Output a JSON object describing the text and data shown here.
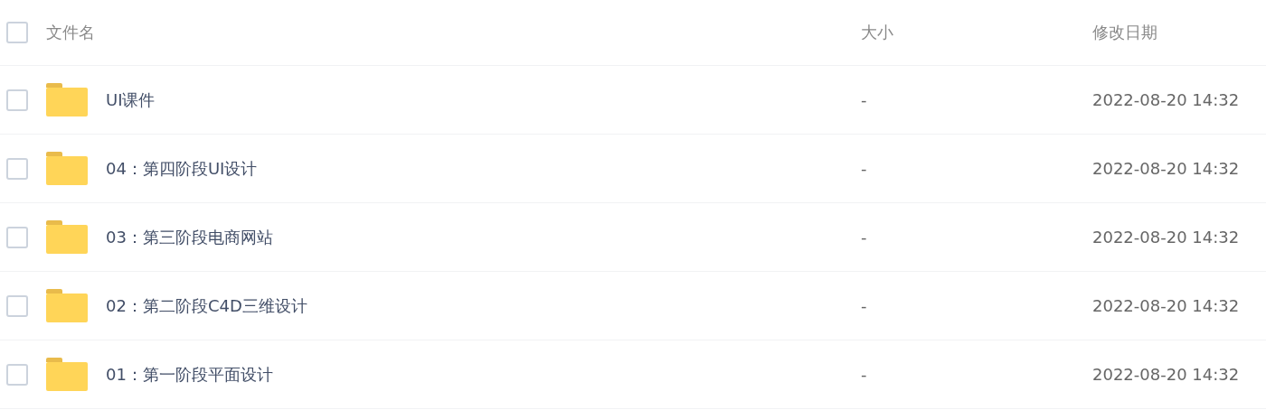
{
  "header": {
    "select_all": {
      "checked": false
    },
    "columns": [
      "文件名",
      "大小",
      "修改日期"
    ]
  },
  "rows": [
    {
      "name": "UI课件",
      "size": "-",
      "modified": "2022-08-20 14:32",
      "checked": false
    },
    {
      "name": "04：第四阶段UI设计",
      "size": "-",
      "modified": "2022-08-20 14:32",
      "checked": false
    },
    {
      "name": "03：第三阶段电商网站",
      "size": "-",
      "modified": "2022-08-20 14:32",
      "checked": false
    },
    {
      "name": "02：第二阶段C4D三维设计",
      "size": "-",
      "modified": "2022-08-20 14:32",
      "checked": false
    },
    {
      "name": "01：第一阶段平面设计",
      "size": "-",
      "modified": "2022-08-20 14:32",
      "checked": false
    }
  ]
}
